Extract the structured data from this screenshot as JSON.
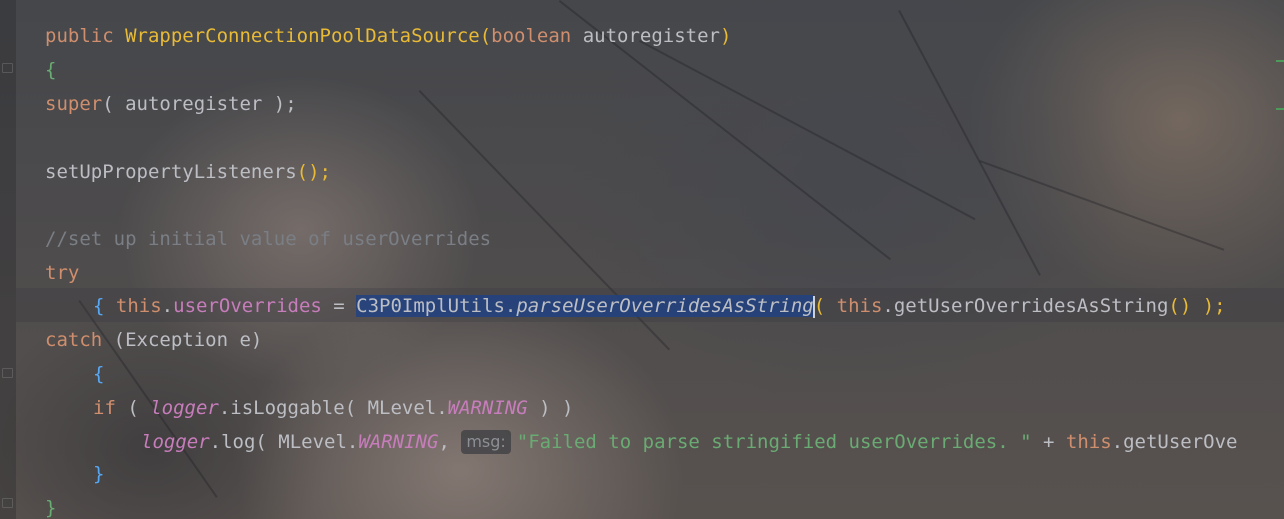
{
  "editor": {
    "language": "java",
    "theme_colors": {
      "keyword": "#cf8e6d",
      "string": "#6aab73",
      "comment": "#7a7e85",
      "field": "#c77dbb",
      "selection": "#214283"
    },
    "lines": {
      "l1": {
        "kw_public": "public",
        "name": "WrapperConnectionPoolDataSource",
        "open_paren": "(",
        "kw_boolean": "boolean",
        "param": "autoregister",
        "close_paren": ")"
      },
      "l2": {
        "brace": "{"
      },
      "l3": {
        "kw_super": "super",
        "args": "( autoregister );"
      },
      "l4": {
        "call": "setUpPropertyListeners",
        "parens": "();"
      },
      "l5": {
        "comment": "//set up initial value of userOverrides"
      },
      "l6": {
        "kw_try": "try"
      },
      "l7": {
        "brace": "{",
        "kw_this": "this",
        "field": "userOverrides",
        "assign": " = ",
        "class_name": "C3P0ImplUtils.",
        "method": "parseUserOverridesAsString",
        "args_open": "( ",
        "kw_this2": "this",
        "call2": ".getUserOverridesAsString",
        "args_close": "() );"
      },
      "l8": {
        "kw_catch": "catch",
        "clause": " (Exception e)"
      },
      "l9": {
        "brace": "{"
      },
      "l10": {
        "kw_if": "if",
        "open": " ( ",
        "logger": "logger",
        "call": ".isLoggable( MLevel.",
        "level": "WARNING",
        "close": " ) )"
      },
      "l11": {
        "logger": "logger",
        "call": ".log( MLevel.",
        "level": "WARNING",
        "comma": ", ",
        "hint": "msg:",
        "message": "\"Failed to parse stringified userOverrides. \"",
        "plus": " + ",
        "kw_this": "this",
        "rest": ".getUserOve"
      },
      "l12": {
        "brace": "}"
      },
      "l13": {
        "brace": "}"
      }
    }
  }
}
